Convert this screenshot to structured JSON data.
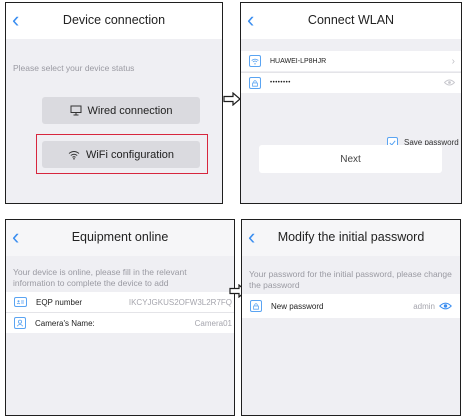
{
  "screens": {
    "device_connection": {
      "title": "Device connection",
      "hint": "Please select your device status",
      "wired_label": "Wired connection",
      "wifi_label": "WiFi configuration",
      "icons": [
        "chevron-left-icon",
        "monitor-icon",
        "wifi-icon"
      ]
    },
    "connect_wlan": {
      "title": "Connect WLAN",
      "ssid": "HUAWEI-LP8HJR",
      "password": "••••••••",
      "save_password_label": "Save password",
      "save_password_checked": true,
      "next_label": "Next",
      "icons": [
        "chevron-left-icon",
        "wifi-icon",
        "lock-icon",
        "chevron-right-icon",
        "eye-icon",
        "checkbox-icon"
      ]
    },
    "equipment_online": {
      "title": "Equipment online",
      "hint": "Your device is online, please fill in the relevant information to complete the device to add",
      "eqp_label": "EQP number",
      "eqp_value": "IKCYJGKUS2OFW3L2R7FQ",
      "camera_label": "Camera's Name:",
      "camera_value": "Camera01",
      "icons": [
        "chevron-left-icon",
        "id-card-icon",
        "user-icon"
      ]
    },
    "modify_password": {
      "title": "Modify the initial password",
      "hint": "Your password for the initial password, please change the password",
      "new_password_label": "New password",
      "new_password_value": "admin",
      "icons": [
        "chevron-left-icon",
        "lock-icon",
        "eye-icon"
      ]
    }
  },
  "colors": {
    "accent": "#3b8ef0",
    "highlight_frame": "#d7263d",
    "screen_bg": "#efeff3",
    "button_bg": "#dadadf"
  }
}
